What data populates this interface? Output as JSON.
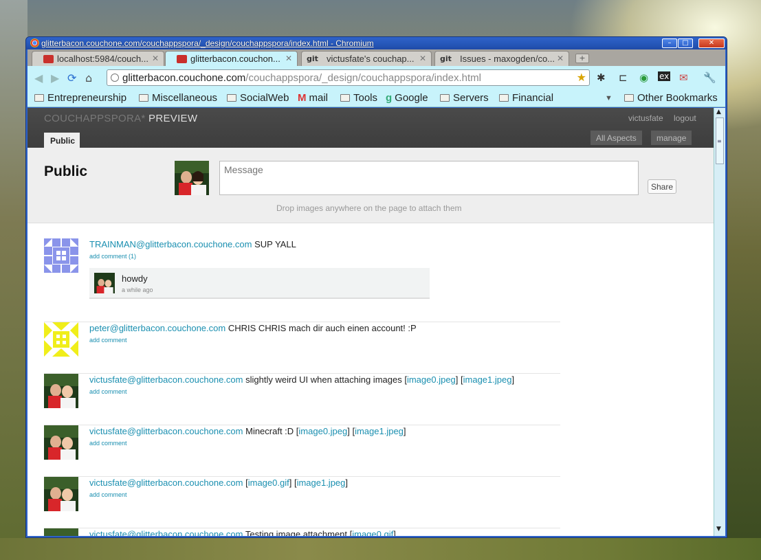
{
  "window": {
    "title": "glitterbacon.couchone.com/couchappspora/_design/couchappspora/index.html - Chromium"
  },
  "tabs": [
    {
      "label": "localhost:5984/couch...",
      "icon": "couchdb-icon"
    },
    {
      "label": "glitterbacon.couchon...",
      "icon": "couchdb-icon",
      "active": true
    },
    {
      "label": "victusfate's couchap...",
      "icon": "git-icon"
    },
    {
      "label": "Issues - maxogden/co...",
      "icon": "git-icon"
    }
  ],
  "address": {
    "host": "glitterbacon.couchone.com",
    "path": "/couchappspora/_design/couchappspora/index.html"
  },
  "bookmarks": [
    {
      "label": "Entrepreneurship"
    },
    {
      "label": "Miscellaneous"
    },
    {
      "label": "SocialWeb"
    },
    {
      "label": "mail"
    },
    {
      "label": "Tools"
    },
    {
      "label": "Google"
    },
    {
      "label": "Servers"
    },
    {
      "label": "Financial"
    }
  ],
  "other_bookmarks": "Other Bookmarks",
  "app": {
    "brand": "COUCHAPPSPORA*",
    "preview": "PREVIEW",
    "user": "victusfate",
    "logout": "logout",
    "public_tab": "Public",
    "all_aspects": "All Aspects",
    "manage": "manage"
  },
  "composer": {
    "title": "Public",
    "placeholder": "Message",
    "share": "Share",
    "drop_hint": "Drop images anywhere on the page to attach them"
  },
  "posts": [
    {
      "author": "TRAINMAN@glitterbacon.couchone.com",
      "text": "SUP YALL",
      "add_comment": "add comment (1)",
      "reply": {
        "text": "howdy",
        "time": "a while ago"
      }
    },
    {
      "author": "peter@glitterbacon.couchone.com",
      "text": "CHRIS CHRIS mach dir auch einen account! :P",
      "add_comment": "add comment"
    },
    {
      "author": "victusfate@glitterbacon.couchone.com",
      "text": "slightly weird UI when attaching images [",
      "img1": "image0.jpeg",
      "mid": "] [",
      "img2": "image1.jpeg",
      "end": "]",
      "add_comment": "add comment"
    },
    {
      "author": "victusfate@glitterbacon.couchone.com",
      "text": "Minecraft :D [",
      "img1": "image0.jpeg",
      "mid": "] [",
      "img2": "image1.jpeg",
      "end": "]",
      "add_comment": "add comment"
    },
    {
      "author": "victusfate@glitterbacon.couchone.com",
      "text": "[",
      "img1": "image0.gif",
      "mid": "] [",
      "img2": "image1.jpeg",
      "end": "]",
      "add_comment": "add comment"
    },
    {
      "author": "victusfate@glitterbacon.couchone.com",
      "text": "Testing image attachment [",
      "img1": "image0.gif",
      "end": "]"
    }
  ]
}
